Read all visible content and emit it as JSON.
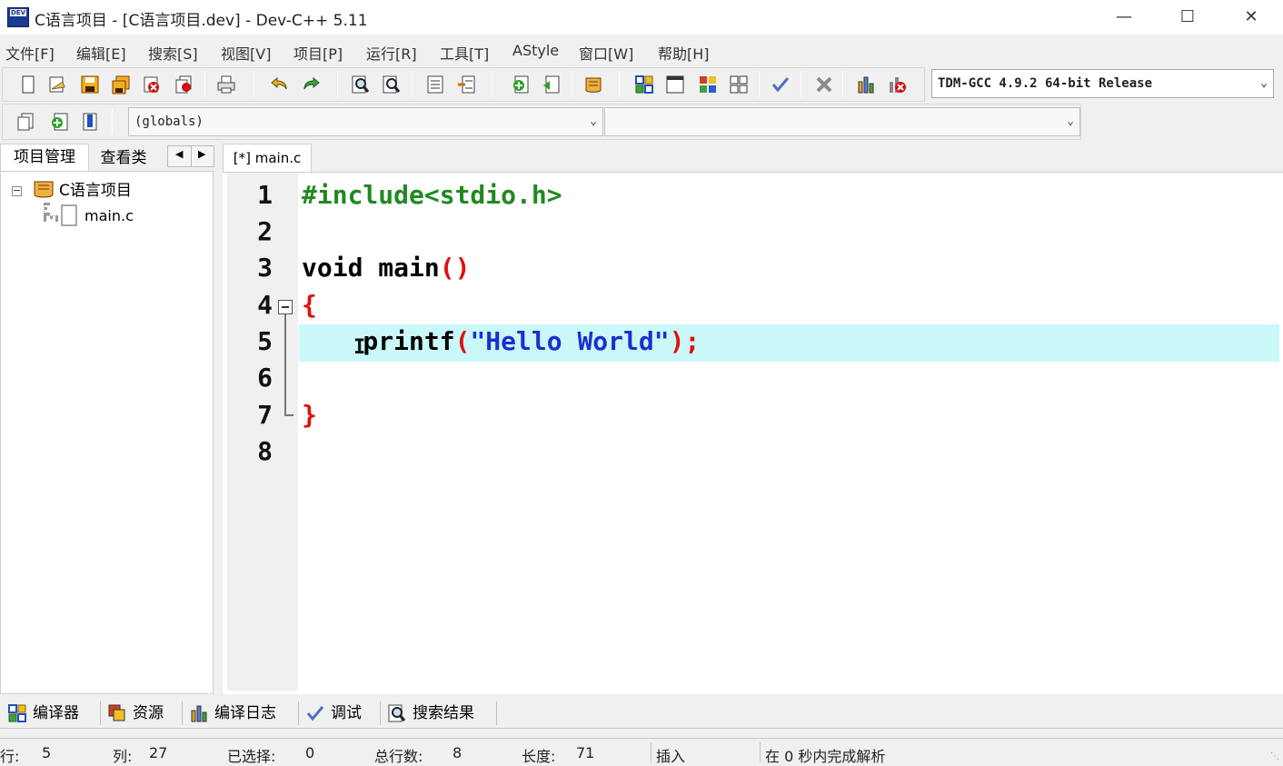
{
  "window": {
    "title": "C语言项目 - [C语言项目.dev] - Dev-C++ 5.11",
    "icon_text": "DEV",
    "minimize": "—",
    "maximize": "☐",
    "close": "✕"
  },
  "menu": [
    "文件[F]",
    "编辑[E]",
    "搜索[S]",
    "视图[V]",
    "项目[P]",
    "运行[R]",
    "工具[T]",
    "AStyle",
    "窗口[W]",
    "帮助[H]"
  ],
  "toolbar": {
    "compiler": "TDM-GCC 4.9.2 64-bit Release",
    "scope_combo": "(globals)",
    "member_combo": ""
  },
  "project_panel": {
    "tabs": [
      "项目管理",
      "查看类"
    ],
    "project_name": "C语言项目",
    "expander": "−",
    "files": [
      "main.c"
    ]
  },
  "editor": {
    "tab_label": "[*] main.c",
    "line_numbers": [
      "1",
      "2",
      "3",
      "4",
      "5",
      "6",
      "7",
      "8"
    ],
    "lines": [
      [
        {
          "text": "#include<stdio.h>",
          "color": "#1f8a1f"
        }
      ],
      [],
      [
        {
          "text": "void main",
          "color": "#000000"
        },
        {
          "text": "()",
          "color": "#e01010"
        }
      ],
      [
        {
          "text": "{",
          "color": "#e01010"
        }
      ],
      [
        {
          "text": "    printf",
          "color": "#000000"
        },
        {
          "text": "(",
          "color": "#e01010"
        },
        {
          "text": "\"Hello World\"",
          "color": "#1a2fd0"
        },
        {
          "text": ");",
          "color": "#e01010"
        }
      ],
      [],
      [
        {
          "text": "}",
          "color": "#e01010"
        }
      ],
      []
    ],
    "current_line_color": "#caf8f8"
  },
  "bottom_tabs": [
    "编译器",
    "资源",
    "编译日志",
    "调试",
    "搜索结果"
  ],
  "status": {
    "row_label": "行:",
    "row": "5",
    "col_label": "列:",
    "col": "27",
    "sel_label": "已选择:",
    "sel": "0",
    "total_label": "总行数:",
    "total": "8",
    "len_label": "长度:",
    "len": "71",
    "mode": "插入",
    "parse": "在 0 秒内完成解析"
  }
}
